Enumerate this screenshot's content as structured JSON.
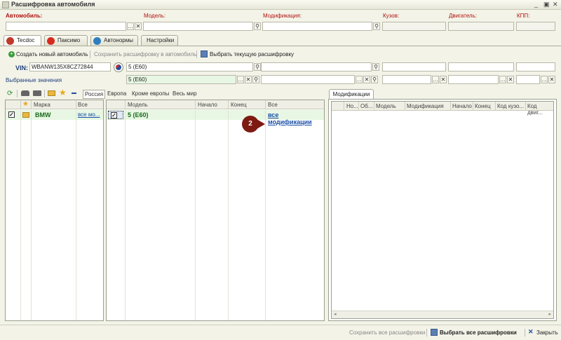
{
  "window": {
    "title": "Расшифровка автомобиля",
    "minimize": "_",
    "restore": "▣",
    "close": "✕"
  },
  "filters": {
    "car_label": "Автомобиль:",
    "model_label": "Модель:",
    "modification_label": "Модификация:",
    "body_label": "Кузов:",
    "engine_label": "Двигатель:",
    "kpp_label": "КПП:"
  },
  "tabs": [
    {
      "label": "Tecdoc",
      "color": "#c0392b"
    },
    {
      "label": "Паксимо",
      "color": "#d62b1f"
    },
    {
      "label": "Автонормы",
      "color": "#2f7fc0"
    },
    {
      "label": "Настройки",
      "color": ""
    }
  ],
  "toolbar": {
    "create_car": "Создать новый автомобиль",
    "save_decoding": "Сохранить расшифровку в автомобиль",
    "select_current": "Выбрать текущую расшифровку"
  },
  "vin": {
    "label": "VIN:",
    "value": "WBANW135X8CZ72844",
    "model_value": "5 (E60)"
  },
  "selected": {
    "label": "Выбранные значения",
    "model_value": "5 (E60)"
  },
  "regions": [
    "Россия",
    "Европа",
    "Кроме европы",
    "Весь мир"
  ],
  "brands_table": {
    "headers": [
      "Марка",
      "Все"
    ],
    "rows": [
      {
        "brand": "BMW",
        "all": "все мо..."
      }
    ]
  },
  "models_table": {
    "headers": [
      "Модель",
      "Начало",
      "Конец",
      "Все"
    ],
    "rows": [
      {
        "model": "5 (E60)",
        "start": "",
        "end": "",
        "all": "все модификации"
      }
    ]
  },
  "modifications_panel": {
    "tab": "Модификации",
    "headers": [
      "Но...",
      "Об...",
      "Модель",
      "Модификация",
      "Начало",
      "Конец",
      "Код кузо...",
      "Код двиг..."
    ]
  },
  "annotation": "2",
  "bottom": {
    "save_all": "Сохранить все расшифровки",
    "select_all": "Выбрать все расшифровки",
    "close": "Закрыть"
  }
}
